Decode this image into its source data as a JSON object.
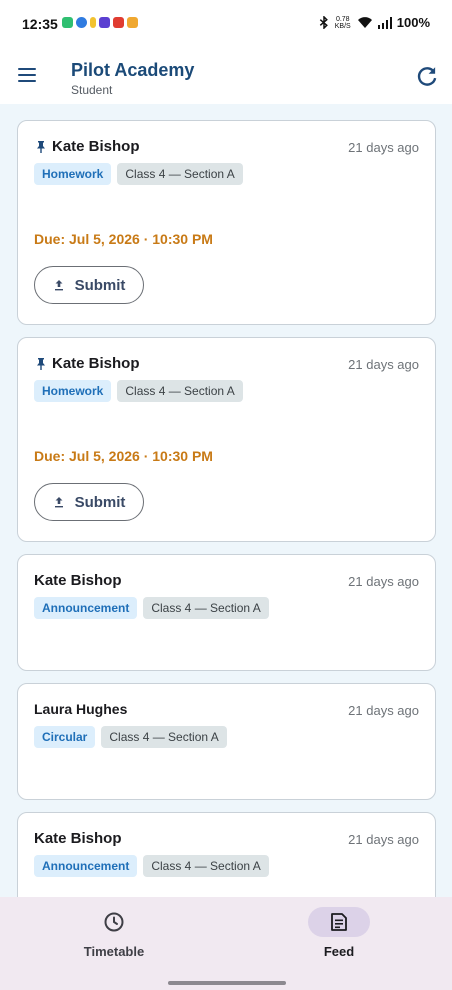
{
  "status_bar": {
    "time": "12:35",
    "speed_value": "0.78",
    "speed_unit": "KB/S",
    "battery": "100%",
    "app_icon_colors": [
      "#2fbf71",
      "#2f7be0",
      "#f2c230",
      "#5b3fd1",
      "#e03c31",
      "#f0a830"
    ]
  },
  "app_bar": {
    "title": "Pilot Academy",
    "subtitle": "Student",
    "menu_icon": "menu-icon",
    "refresh_icon": "refresh-icon"
  },
  "feed": {
    "cards": [
      {
        "author": "Kate Bishop",
        "pinned": true,
        "time": "21 days ago",
        "type_tag": "Homework",
        "class_tag": "Class 4 — Section A",
        "due": "Due: Jul 5, 2026 · 10:30 PM",
        "submit_label": "Submit"
      },
      {
        "author": "Kate Bishop",
        "pinned": true,
        "time": "21 days ago",
        "type_tag": "Homework",
        "class_tag": "Class 4 — Section A",
        "due": "Due: Jul 5, 2026 · 10:30 PM",
        "submit_label": "Submit"
      },
      {
        "author": "Kate Bishop",
        "pinned": false,
        "time": "21 days ago",
        "type_tag": "Announcement",
        "class_tag": "Class 4 — Section A"
      },
      {
        "author": "Laura Hughes",
        "pinned": false,
        "time": "21 days ago",
        "type_tag": "Circular",
        "class_tag": "Class 4 — Section A"
      },
      {
        "author": "Kate Bishop",
        "pinned": false,
        "time": "21 days ago",
        "type_tag": "Announcement",
        "class_tag": "Class 4 — Section A"
      }
    ]
  },
  "bottom_nav": {
    "items": [
      {
        "label": "Timetable",
        "icon": "clock-icon",
        "active": false
      },
      {
        "label": "Feed",
        "icon": "feed-icon",
        "active": true
      }
    ]
  },
  "colors": {
    "accent": "#1b4a78",
    "due_text": "#c87a16",
    "feed_background": "#eef6fb",
    "nav_background": "#f1e9f1"
  }
}
